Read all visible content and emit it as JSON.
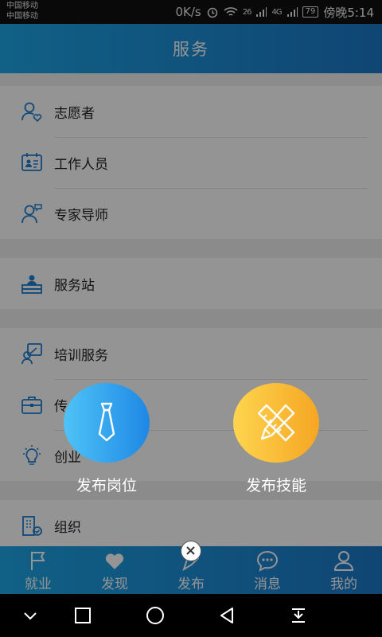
{
  "status_bar": {
    "carrier_1": "中国移动",
    "carrier_2": "中国移动",
    "net_speed": "0K/s",
    "sig_1": "26",
    "sig_2": "4G",
    "battery": "79",
    "time": "傍晚5:14"
  },
  "header": {
    "title": "服务"
  },
  "groups": [
    {
      "items": [
        {
          "label": "志愿者",
          "icon": "volunteer-heart-icon"
        },
        {
          "label": "工作人员",
          "icon": "staff-id-card-icon"
        },
        {
          "label": "专家导师",
          "icon": "expert-mentor-icon"
        }
      ]
    },
    {
      "items": [
        {
          "label": "服务站",
          "icon": "service-station-icon"
        }
      ]
    },
    {
      "items": [
        {
          "label": "培训服务",
          "icon": "training-icon"
        },
        {
          "label": "传",
          "icon": "briefcase-icon"
        },
        {
          "label": "创业",
          "icon": "lightbulb-icon"
        }
      ]
    },
    {
      "items": [
        {
          "label": "组织",
          "icon": "organization-icon"
        }
      ]
    }
  ],
  "tabbar": [
    {
      "label": "就业",
      "icon": "flag-icon"
    },
    {
      "label": "发现",
      "icon": "heart-icon"
    },
    {
      "label": "发布",
      "icon": "publish-icon"
    },
    {
      "label": "消息",
      "icon": "chat-bubble-icon"
    },
    {
      "label": "我的",
      "icon": "user-icon"
    }
  ],
  "popup": {
    "job_label": "发布岗位",
    "skill_label": "发布技能",
    "job_icon": "necktie-icon",
    "skill_icon": "pencil-ruler-icon",
    "close_icon": "close-circle-icon"
  },
  "colors": {
    "brand_start": "#1ea6e8",
    "brand_end": "#1b78c8",
    "icon_blue": "#1e7fd0",
    "job_start": "#4fc3f7",
    "job_end": "#1e88e5",
    "skill_start": "#ffd54f",
    "skill_end": "#f5a623"
  }
}
